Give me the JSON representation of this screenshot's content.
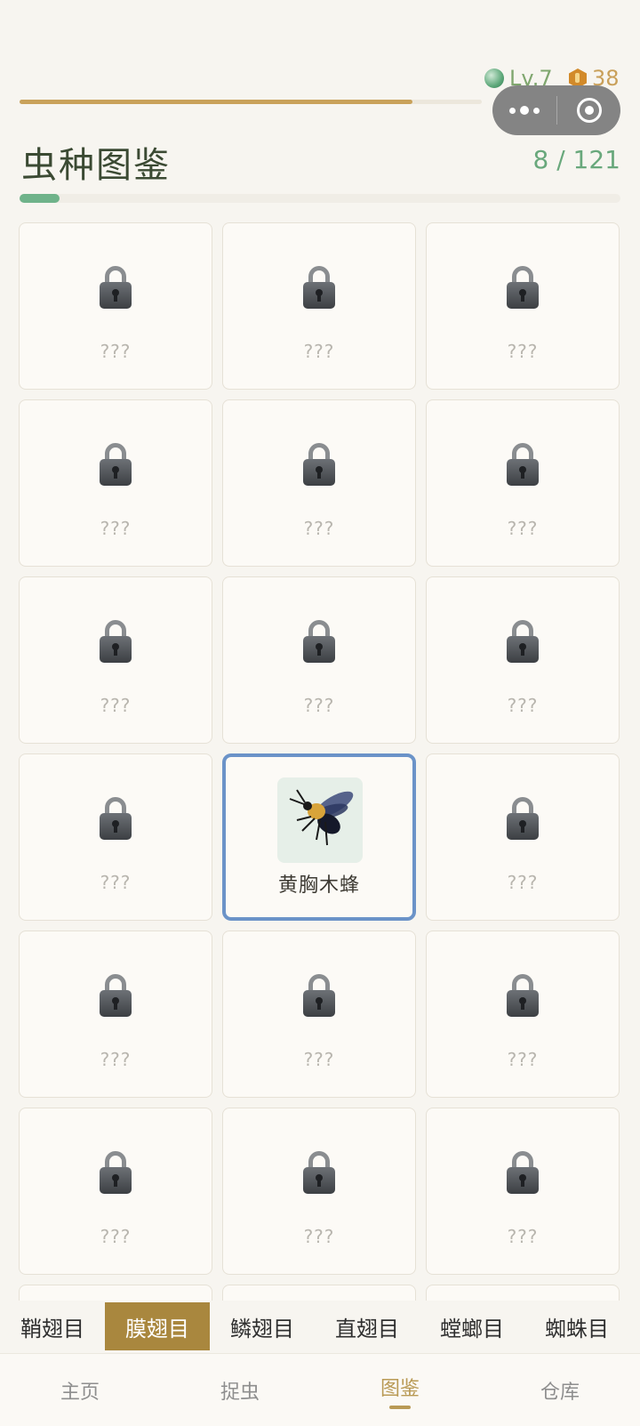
{
  "status": {
    "level_label": "Lv.7",
    "coins": "38",
    "xp_progress": 0.85
  },
  "capsule": {
    "more_icon": "more-dots-icon",
    "close_icon": "close-circle-icon"
  },
  "header": {
    "title": "虫种图鉴",
    "count": "8 / 121",
    "collection_progress": 0.066
  },
  "grid": {
    "cards": [
      {
        "label": "???",
        "locked": true
      },
      {
        "label": "???",
        "locked": true
      },
      {
        "label": "???",
        "locked": true
      },
      {
        "label": "???",
        "locked": true
      },
      {
        "label": "???",
        "locked": true
      },
      {
        "label": "???",
        "locked": true
      },
      {
        "label": "???",
        "locked": true
      },
      {
        "label": "???",
        "locked": true
      },
      {
        "label": "???",
        "locked": true
      },
      {
        "label": "???",
        "locked": true
      },
      {
        "label": "黄胸木蜂",
        "locked": false,
        "selected": true
      },
      {
        "label": "???",
        "locked": true
      },
      {
        "label": "???",
        "locked": true
      },
      {
        "label": "???",
        "locked": true
      },
      {
        "label": "???",
        "locked": true
      },
      {
        "label": "???",
        "locked": true
      },
      {
        "label": "???",
        "locked": true
      },
      {
        "label": "???",
        "locked": true
      },
      {
        "label": "",
        "locked": false
      },
      {
        "label": "",
        "locked": false
      },
      {
        "label": "",
        "locked": false
      }
    ]
  },
  "categories": {
    "items": [
      "鞘翅目",
      "膜翅目",
      "鳞翅目",
      "直翅目",
      "螳螂目",
      "蜘蛛目"
    ],
    "active_index": 1
  },
  "bottom_nav": {
    "items": [
      "主页",
      "捉虫",
      "图鉴",
      "仓库"
    ],
    "active_index": 2
  },
  "colors": {
    "accent_gold": "#a9873e",
    "selected_border": "#6b93c8",
    "progress_green": "#6fb38a"
  }
}
